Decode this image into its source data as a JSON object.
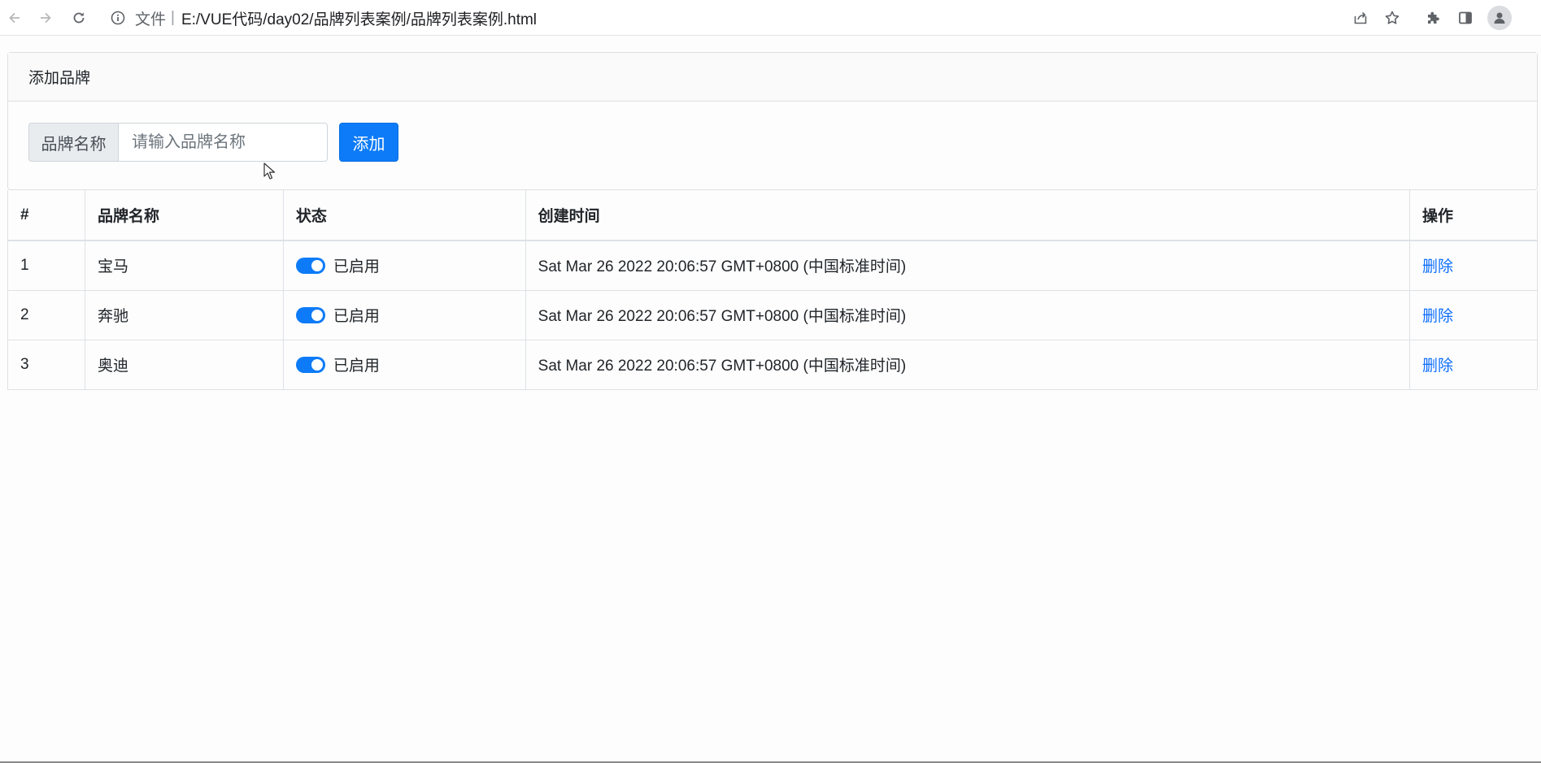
{
  "browser": {
    "scheme_label": "文件",
    "separator": "|",
    "url": "E:/VUE代码/day02/品牌列表案例/品牌列表案例.html"
  },
  "card": {
    "header": "添加品牌",
    "input_addon": "品牌名称",
    "input_placeholder": "请输入品牌名称",
    "input_value": "",
    "add_label": "添加"
  },
  "table": {
    "headers": [
      "#",
      "品牌名称",
      "状态",
      "创建时间",
      "操作"
    ],
    "rows": [
      {
        "id": "1",
        "name": "宝马",
        "status": "已启用",
        "enabled": true,
        "time": "Sat Mar 26 2022 20:06:57 GMT+0800 (中国标准时间)",
        "action": "删除"
      },
      {
        "id": "2",
        "name": "奔驰",
        "status": "已启用",
        "enabled": true,
        "time": "Sat Mar 26 2022 20:06:57 GMT+0800 (中国标准时间)",
        "action": "删除"
      },
      {
        "id": "3",
        "name": "奥迪",
        "status": "已启用",
        "enabled": true,
        "time": "Sat Mar 26 2022 20:06:57 GMT+0800 (中国标准时间)",
        "action": "删除"
      }
    ]
  },
  "colors": {
    "primary": "#0d7bf7",
    "link": "#0d6efd",
    "border": "#dee2e6"
  },
  "icons": [
    "back-icon",
    "forward-icon",
    "reload-icon",
    "info-icon",
    "share-icon",
    "star-icon",
    "extensions-icon",
    "sidepanel-icon",
    "profile-icon"
  ]
}
